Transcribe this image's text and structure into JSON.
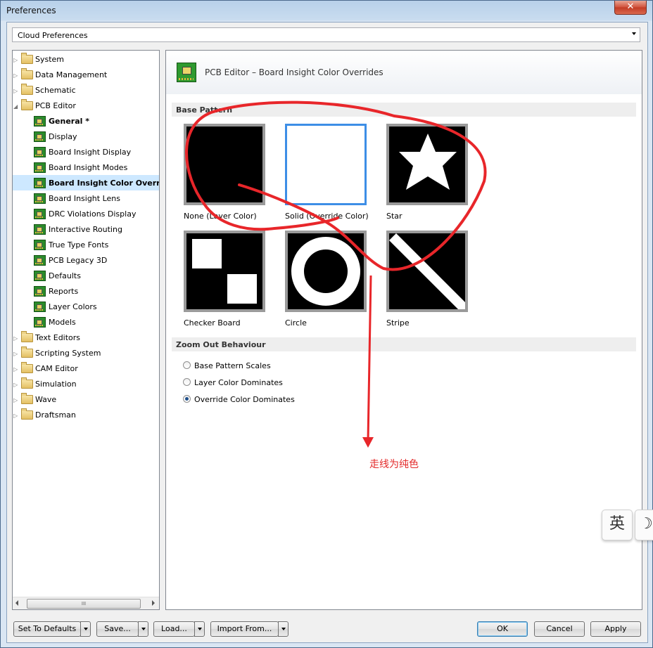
{
  "window": {
    "title": "Preferences",
    "close_glyph": "✕"
  },
  "combo": {
    "value": "Cloud Preferences"
  },
  "tree": {
    "items": [
      {
        "label": "System",
        "kind": "folder",
        "level": 0
      },
      {
        "label": "Data Management",
        "kind": "folder",
        "level": 0
      },
      {
        "label": "Schematic",
        "kind": "folder",
        "level": 0
      },
      {
        "label": "PCB Editor",
        "kind": "folder-open",
        "level": 0
      },
      {
        "label": "General *",
        "kind": "page",
        "level": 1,
        "bold": true
      },
      {
        "label": "Display",
        "kind": "page",
        "level": 1
      },
      {
        "label": "Board Insight Display",
        "kind": "page",
        "level": 1
      },
      {
        "label": "Board Insight Modes",
        "kind": "page",
        "level": 1
      },
      {
        "label": "Board Insight Color Overrides",
        "kind": "page",
        "level": 1,
        "selected": true
      },
      {
        "label": "Board Insight Lens",
        "kind": "page",
        "level": 1
      },
      {
        "label": "DRC Violations Display",
        "kind": "page",
        "level": 1
      },
      {
        "label": "Interactive Routing",
        "kind": "page",
        "level": 1
      },
      {
        "label": "True Type Fonts",
        "kind": "page",
        "level": 1
      },
      {
        "label": "PCB Legacy 3D",
        "kind": "page",
        "level": 1
      },
      {
        "label": "Defaults",
        "kind": "page",
        "level": 1
      },
      {
        "label": "Reports",
        "kind": "page",
        "level": 1
      },
      {
        "label": "Layer Colors",
        "kind": "page",
        "level": 1
      },
      {
        "label": "Models",
        "kind": "page",
        "level": 1
      },
      {
        "label": "Text Editors",
        "kind": "folder",
        "level": 0
      },
      {
        "label": "Scripting System",
        "kind": "folder",
        "level": 0
      },
      {
        "label": "CAM Editor",
        "kind": "folder",
        "level": 0
      },
      {
        "label": "Simulation",
        "kind": "folder",
        "level": 0
      },
      {
        "label": "Wave",
        "kind": "folder",
        "level": 0
      },
      {
        "label": "Draftsman",
        "kind": "folder",
        "level": 0
      }
    ],
    "scroll_thumb_glyph": "III"
  },
  "panel": {
    "title": "PCB Editor – Board Insight Color Overrides",
    "base_pattern": {
      "section_label": "Base Pattern",
      "tiles": [
        {
          "label": "None (Layer Color)",
          "pattern": "none"
        },
        {
          "label": "Solid (Override Color)",
          "pattern": "solid",
          "selected": true
        },
        {
          "label": "Star",
          "pattern": "star"
        },
        {
          "label": "Checker Board",
          "pattern": "checker"
        },
        {
          "label": "Circle",
          "pattern": "circle"
        },
        {
          "label": "Stripe",
          "pattern": "stripe"
        }
      ]
    },
    "zoom_out": {
      "section_label": "Zoom Out Behaviour",
      "options": [
        {
          "label": "Base Pattern Scales",
          "checked": false
        },
        {
          "label": "Layer Color Dominates",
          "checked": false
        },
        {
          "label": "Override Color Dominates",
          "checked": true
        }
      ]
    }
  },
  "buttons": {
    "set_to_defaults": "Set To Defaults",
    "save": "Save...",
    "load": "Load...",
    "import_from": "Import From...",
    "ok": "OK",
    "cancel": "Cancel",
    "apply": "Apply"
  },
  "annotation": {
    "text": "走线为纯色",
    "color": "#e32a2a"
  },
  "ime": {
    "lang_glyph": "英",
    "moon_glyph": "☽"
  },
  "colors": {
    "selection": "#cde8ff",
    "selected_tile_border": "#3d8ee6",
    "annotation_red": "#e8262a"
  }
}
